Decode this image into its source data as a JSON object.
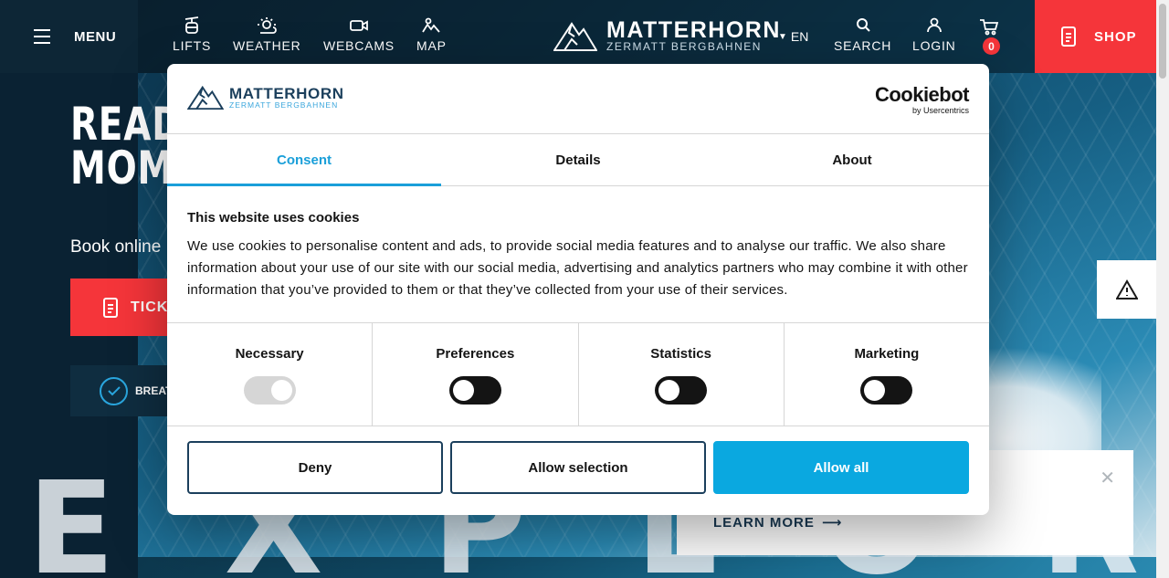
{
  "header": {
    "menu_label": "MENU",
    "nav": [
      {
        "label": "LIFTS",
        "icon": "lift-icon"
      },
      {
        "label": "WEATHER",
        "icon": "weather-icon"
      },
      {
        "label": "WEBCAMS",
        "icon": "webcam-icon"
      },
      {
        "label": "MAP",
        "icon": "map-icon"
      }
    ],
    "logo_name": "MATTERHORN",
    "logo_tag": "ZERMATT BERGBAHNEN",
    "lang": "EN",
    "search_label": "SEARCH",
    "login_label": "LOGIN",
    "cart_count": "0",
    "shop_label": "SHOP"
  },
  "hero": {
    "title_line1": "READY",
    "title_line2": "MOME",
    "subtitle": "Book online",
    "tickets_label": "TICKE",
    "breath_label": "BREAT",
    "big_word": "EXPLORE"
  },
  "notice": {
    "learn_more": "LEARN MORE"
  },
  "cookie_dialog": {
    "logo_name": "MATTERHORN",
    "logo_tag": "ZERMATT BERGBAHNEN",
    "provider_name": "Cookiebot",
    "provider_by": "by Usercentrics",
    "tabs": [
      {
        "label": "Consent",
        "active": true
      },
      {
        "label": "Details",
        "active": false
      },
      {
        "label": "About",
        "active": false
      }
    ],
    "heading": "This website uses cookies",
    "text": "We use cookies to personalise content and ads, to provide social media features and to analyse our traffic. We also share information about your use of our site with our social media, advertising and analytics partners who may combine it with other information that you’ve provided to them or that they’ve collected from your use of their services.",
    "categories": [
      {
        "label": "Necessary",
        "state": "on-locked"
      },
      {
        "label": "Preferences",
        "state": "off"
      },
      {
        "label": "Statistics",
        "state": "off"
      },
      {
        "label": "Marketing",
        "state": "off"
      }
    ],
    "deny_label": "Deny",
    "allow_selection_label": "Allow selection",
    "allow_all_label": "Allow all"
  },
  "colors": {
    "accent_red": "#f5353a",
    "cookie_blue": "#0aa8e0",
    "brand_navy": "#1b3f5c"
  }
}
